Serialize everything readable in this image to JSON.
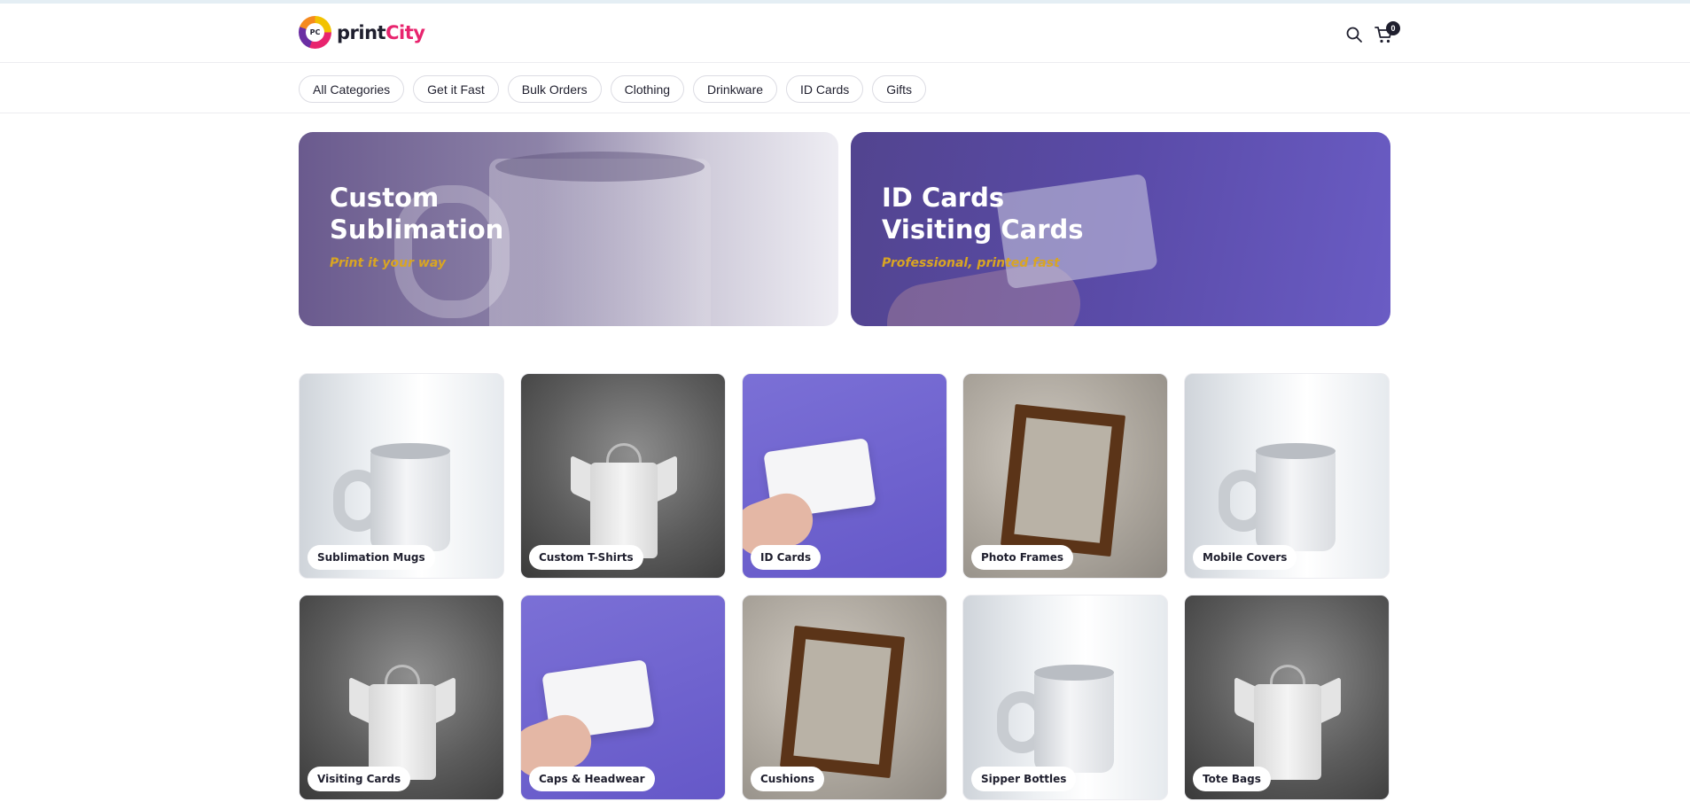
{
  "brand": {
    "logo_mark": "PC",
    "name_part1": "print",
    "name_part2": "City"
  },
  "header": {
    "search_icon": "search-icon",
    "cart_icon": "cart-icon",
    "cart_count": "0"
  },
  "categories": [
    {
      "label": "All Categories"
    },
    {
      "label": "Get it Fast"
    },
    {
      "label": "Bulk Orders"
    },
    {
      "label": "Clothing"
    },
    {
      "label": "Drinkware"
    },
    {
      "label": "ID Cards"
    },
    {
      "label": "Gifts"
    }
  ],
  "banners": [
    {
      "title_line1": "Custom",
      "title_line2": "Sublimation",
      "subtitle": "Print it your way"
    },
    {
      "title_line1": "ID Cards",
      "title_line2": "Visiting Cards",
      "subtitle": "Professional, printed fast"
    }
  ],
  "products": [
    {
      "label": "Sublimation Mugs",
      "image": "mug"
    },
    {
      "label": "Custom T-Shirts",
      "image": "shirt"
    },
    {
      "label": "ID Cards",
      "image": "card"
    },
    {
      "label": "Photo Frames",
      "image": "frame"
    },
    {
      "label": "Mobile Covers",
      "image": "mug"
    },
    {
      "label": "Visiting Cards",
      "image": "shirt"
    },
    {
      "label": "Caps & Headwear",
      "image": "card"
    },
    {
      "label": "Cushions",
      "image": "frame"
    },
    {
      "label": "Sipper Bottles",
      "image": "mug"
    },
    {
      "label": "Tote Bags",
      "image": "shirt"
    }
  ],
  "colors": {
    "brand_pink": "#e8246e",
    "accent_gold": "#d9a523",
    "text_dark": "#1f1f2e"
  }
}
